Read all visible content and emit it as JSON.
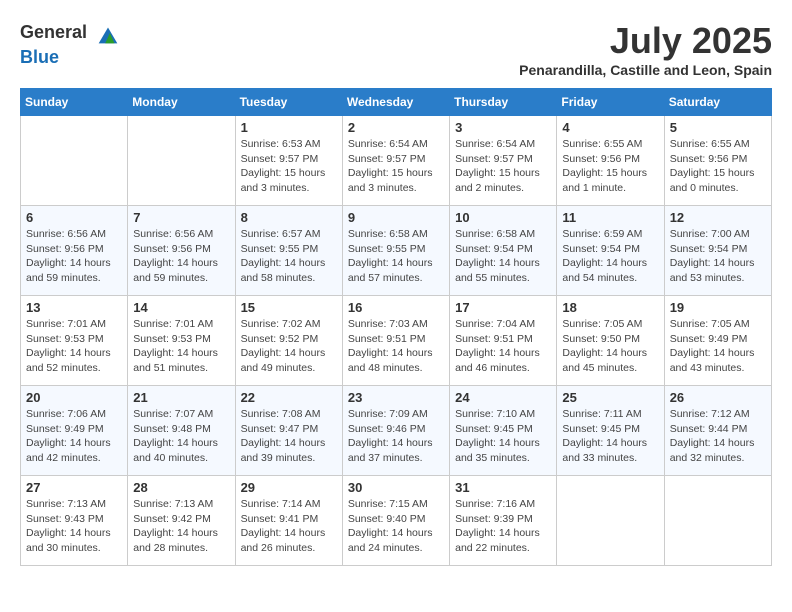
{
  "header": {
    "logo_general": "General",
    "logo_blue": "Blue",
    "month_title": "July 2025",
    "location": "Penarandilla, Castille and Leon, Spain"
  },
  "calendar": {
    "days_of_week": [
      "Sunday",
      "Monday",
      "Tuesday",
      "Wednesday",
      "Thursday",
      "Friday",
      "Saturday"
    ],
    "weeks": [
      [
        {
          "day": "",
          "sunrise": "",
          "sunset": "",
          "daylight": "",
          "empty": true
        },
        {
          "day": "",
          "sunrise": "",
          "sunset": "",
          "daylight": "",
          "empty": true
        },
        {
          "day": "1",
          "sunrise": "Sunrise: 6:53 AM",
          "sunset": "Sunset: 9:57 PM",
          "daylight": "Daylight: 15 hours and 3 minutes.",
          "empty": false
        },
        {
          "day": "2",
          "sunrise": "Sunrise: 6:54 AM",
          "sunset": "Sunset: 9:57 PM",
          "daylight": "Daylight: 15 hours and 3 minutes.",
          "empty": false
        },
        {
          "day": "3",
          "sunrise": "Sunrise: 6:54 AM",
          "sunset": "Sunset: 9:57 PM",
          "daylight": "Daylight: 15 hours and 2 minutes.",
          "empty": false
        },
        {
          "day": "4",
          "sunrise": "Sunrise: 6:55 AM",
          "sunset": "Sunset: 9:56 PM",
          "daylight": "Daylight: 15 hours and 1 minute.",
          "empty": false
        },
        {
          "day": "5",
          "sunrise": "Sunrise: 6:55 AM",
          "sunset": "Sunset: 9:56 PM",
          "daylight": "Daylight: 15 hours and 0 minutes.",
          "empty": false
        }
      ],
      [
        {
          "day": "6",
          "sunrise": "Sunrise: 6:56 AM",
          "sunset": "Sunset: 9:56 PM",
          "daylight": "Daylight: 14 hours and 59 minutes.",
          "empty": false
        },
        {
          "day": "7",
          "sunrise": "Sunrise: 6:56 AM",
          "sunset": "Sunset: 9:56 PM",
          "daylight": "Daylight: 14 hours and 59 minutes.",
          "empty": false
        },
        {
          "day": "8",
          "sunrise": "Sunrise: 6:57 AM",
          "sunset": "Sunset: 9:55 PM",
          "daylight": "Daylight: 14 hours and 58 minutes.",
          "empty": false
        },
        {
          "day": "9",
          "sunrise": "Sunrise: 6:58 AM",
          "sunset": "Sunset: 9:55 PM",
          "daylight": "Daylight: 14 hours and 57 minutes.",
          "empty": false
        },
        {
          "day": "10",
          "sunrise": "Sunrise: 6:58 AM",
          "sunset": "Sunset: 9:54 PM",
          "daylight": "Daylight: 14 hours and 55 minutes.",
          "empty": false
        },
        {
          "day": "11",
          "sunrise": "Sunrise: 6:59 AM",
          "sunset": "Sunset: 9:54 PM",
          "daylight": "Daylight: 14 hours and 54 minutes.",
          "empty": false
        },
        {
          "day": "12",
          "sunrise": "Sunrise: 7:00 AM",
          "sunset": "Sunset: 9:54 PM",
          "daylight": "Daylight: 14 hours and 53 minutes.",
          "empty": false
        }
      ],
      [
        {
          "day": "13",
          "sunrise": "Sunrise: 7:01 AM",
          "sunset": "Sunset: 9:53 PM",
          "daylight": "Daylight: 14 hours and 52 minutes.",
          "empty": false
        },
        {
          "day": "14",
          "sunrise": "Sunrise: 7:01 AM",
          "sunset": "Sunset: 9:53 PM",
          "daylight": "Daylight: 14 hours and 51 minutes.",
          "empty": false
        },
        {
          "day": "15",
          "sunrise": "Sunrise: 7:02 AM",
          "sunset": "Sunset: 9:52 PM",
          "daylight": "Daylight: 14 hours and 49 minutes.",
          "empty": false
        },
        {
          "day": "16",
          "sunrise": "Sunrise: 7:03 AM",
          "sunset": "Sunset: 9:51 PM",
          "daylight": "Daylight: 14 hours and 48 minutes.",
          "empty": false
        },
        {
          "day": "17",
          "sunrise": "Sunrise: 7:04 AM",
          "sunset": "Sunset: 9:51 PM",
          "daylight": "Daylight: 14 hours and 46 minutes.",
          "empty": false
        },
        {
          "day": "18",
          "sunrise": "Sunrise: 7:05 AM",
          "sunset": "Sunset: 9:50 PM",
          "daylight": "Daylight: 14 hours and 45 minutes.",
          "empty": false
        },
        {
          "day": "19",
          "sunrise": "Sunrise: 7:05 AM",
          "sunset": "Sunset: 9:49 PM",
          "daylight": "Daylight: 14 hours and 43 minutes.",
          "empty": false
        }
      ],
      [
        {
          "day": "20",
          "sunrise": "Sunrise: 7:06 AM",
          "sunset": "Sunset: 9:49 PM",
          "daylight": "Daylight: 14 hours and 42 minutes.",
          "empty": false
        },
        {
          "day": "21",
          "sunrise": "Sunrise: 7:07 AM",
          "sunset": "Sunset: 9:48 PM",
          "daylight": "Daylight: 14 hours and 40 minutes.",
          "empty": false
        },
        {
          "day": "22",
          "sunrise": "Sunrise: 7:08 AM",
          "sunset": "Sunset: 9:47 PM",
          "daylight": "Daylight: 14 hours and 39 minutes.",
          "empty": false
        },
        {
          "day": "23",
          "sunrise": "Sunrise: 7:09 AM",
          "sunset": "Sunset: 9:46 PM",
          "daylight": "Daylight: 14 hours and 37 minutes.",
          "empty": false
        },
        {
          "day": "24",
          "sunrise": "Sunrise: 7:10 AM",
          "sunset": "Sunset: 9:45 PM",
          "daylight": "Daylight: 14 hours and 35 minutes.",
          "empty": false
        },
        {
          "day": "25",
          "sunrise": "Sunrise: 7:11 AM",
          "sunset": "Sunset: 9:45 PM",
          "daylight": "Daylight: 14 hours and 33 minutes.",
          "empty": false
        },
        {
          "day": "26",
          "sunrise": "Sunrise: 7:12 AM",
          "sunset": "Sunset: 9:44 PM",
          "daylight": "Daylight: 14 hours and 32 minutes.",
          "empty": false
        }
      ],
      [
        {
          "day": "27",
          "sunrise": "Sunrise: 7:13 AM",
          "sunset": "Sunset: 9:43 PM",
          "daylight": "Daylight: 14 hours and 30 minutes.",
          "empty": false
        },
        {
          "day": "28",
          "sunrise": "Sunrise: 7:13 AM",
          "sunset": "Sunset: 9:42 PM",
          "daylight": "Daylight: 14 hours and 28 minutes.",
          "empty": false
        },
        {
          "day": "29",
          "sunrise": "Sunrise: 7:14 AM",
          "sunset": "Sunset: 9:41 PM",
          "daylight": "Daylight: 14 hours and 26 minutes.",
          "empty": false
        },
        {
          "day": "30",
          "sunrise": "Sunrise: 7:15 AM",
          "sunset": "Sunset: 9:40 PM",
          "daylight": "Daylight: 14 hours and 24 minutes.",
          "empty": false
        },
        {
          "day": "31",
          "sunrise": "Sunrise: 7:16 AM",
          "sunset": "Sunset: 9:39 PM",
          "daylight": "Daylight: 14 hours and 22 minutes.",
          "empty": false
        },
        {
          "day": "",
          "sunrise": "",
          "sunset": "",
          "daylight": "",
          "empty": true
        },
        {
          "day": "",
          "sunrise": "",
          "sunset": "",
          "daylight": "",
          "empty": true
        }
      ]
    ]
  }
}
